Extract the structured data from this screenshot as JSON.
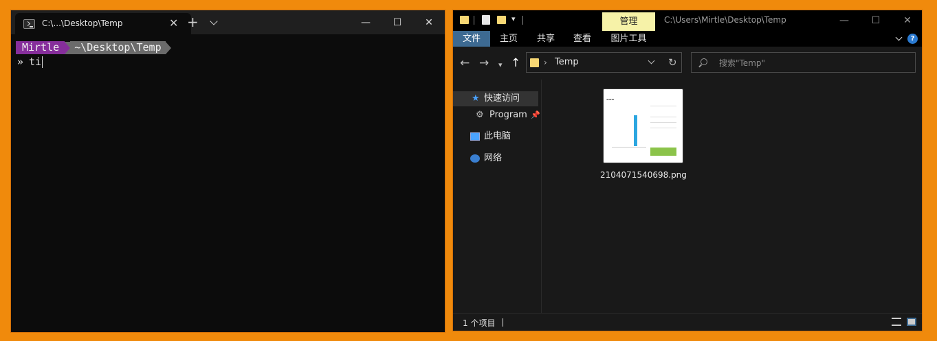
{
  "terminal": {
    "tab_title": "C:\\...\\Desktop\\Temp",
    "tab_close": "✕",
    "new_tab": "+",
    "prompt_user": "Mirtle",
    "prompt_path": "~\\Desktop\\Temp",
    "prompt_symbol": "»",
    "command_text": "ti",
    "controls": {
      "minimize": "—",
      "maximize": "☐",
      "close": "✕"
    }
  },
  "explorer": {
    "manage_tab": "管理",
    "title": "C:\\Users\\Mirtle\\Desktop\\Temp",
    "controls": {
      "minimize": "—",
      "maximize": "☐",
      "close": "✕"
    },
    "ribbon_tabs": [
      "文件",
      "主页",
      "共享",
      "查看",
      "图片工具"
    ],
    "help": "?",
    "address": "Temp",
    "search_placeholder": "搜索\"Temp\"",
    "nav_items": [
      "快速访问",
      "Program",
      "此电脑",
      "网络"
    ],
    "file": {
      "name": "2104071540698.png"
    },
    "status_text": "1 个项目",
    "colors": {
      "accent_ribbon": "#3d6a92",
      "manage_tab": "#f6f2a8",
      "folder": "#f7d774",
      "prompt_user_bg": "#862e9b",
      "prompt_path_bg": "#6b6b6b"
    },
    "icons": [
      "folder-icon",
      "checkbox-icon",
      "back-icon",
      "forward-icon",
      "up-icon",
      "refresh-icon",
      "search-icon",
      "star-icon",
      "pin-icon",
      "pc-icon",
      "network-icon",
      "help-icon"
    ]
  }
}
